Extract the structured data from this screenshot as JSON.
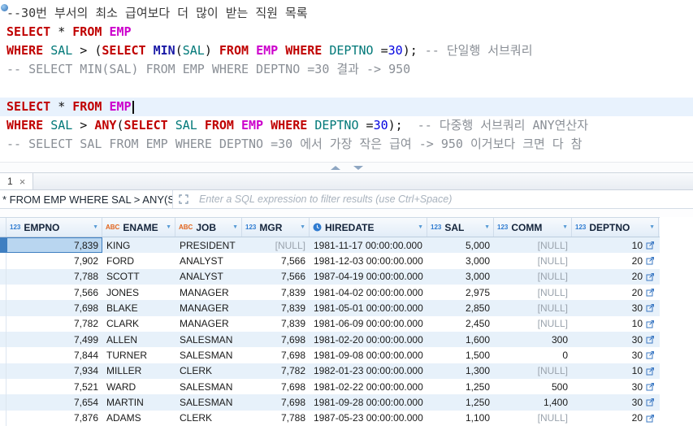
{
  "editor": {
    "lines": [
      {
        "tokens": [
          [
            "cmt1",
            "--30번 부서의 최소 급여보다 더 많이 받는 직원 목록"
          ]
        ]
      },
      {
        "tokens": [
          [
            "kw",
            "SELECT"
          ],
          [
            "pl",
            " * "
          ],
          [
            "kw",
            "FROM"
          ],
          [
            "pl",
            " "
          ],
          [
            "tbl",
            "EMP"
          ]
        ]
      },
      {
        "tokens": [
          [
            "kw",
            "WHERE"
          ],
          [
            "pl",
            " "
          ],
          [
            "col",
            "SAL"
          ],
          [
            "pl",
            " > ("
          ],
          [
            "kw",
            "SELECT"
          ],
          [
            "pl",
            " "
          ],
          [
            "fn",
            "MIN"
          ],
          [
            "pl",
            "("
          ],
          [
            "col",
            "SAL"
          ],
          [
            "pl",
            ") "
          ],
          [
            "kw",
            "FROM"
          ],
          [
            "pl",
            " "
          ],
          [
            "tbl",
            "EMP"
          ],
          [
            "pl",
            " "
          ],
          [
            "kw",
            "WHERE"
          ],
          [
            "pl",
            " "
          ],
          [
            "col",
            "DEPTNO"
          ],
          [
            "pl",
            " ="
          ],
          [
            "num",
            "30"
          ],
          [
            "pl",
            "); "
          ],
          [
            "cmt",
            "-- 단일행 서브쿼리"
          ]
        ]
      },
      {
        "tokens": [
          [
            "cmt",
            "-- SELECT MIN(SAL) FROM EMP WHERE DEPTNO =30 결과 -> 950"
          ]
        ]
      },
      {
        "tokens": []
      },
      {
        "current": true,
        "caret": true,
        "tokens": [
          [
            "kw",
            "SELECT"
          ],
          [
            "pl",
            " * "
          ],
          [
            "kw",
            "FROM"
          ],
          [
            "pl",
            " "
          ],
          [
            "tbl",
            "EMP"
          ]
        ]
      },
      {
        "tokens": [
          [
            "kw",
            "WHERE"
          ],
          [
            "pl",
            " "
          ],
          [
            "col",
            "SAL"
          ],
          [
            "pl",
            " > "
          ],
          [
            "kw",
            "ANY"
          ],
          [
            "pl",
            "("
          ],
          [
            "kw",
            "SELECT"
          ],
          [
            "pl",
            " "
          ],
          [
            "col",
            "SAL"
          ],
          [
            "pl",
            " "
          ],
          [
            "kw",
            "FROM"
          ],
          [
            "pl",
            " "
          ],
          [
            "tbl",
            "EMP"
          ],
          [
            "pl",
            " "
          ],
          [
            "kw",
            "WHERE"
          ],
          [
            "pl",
            " "
          ],
          [
            "col",
            "DEPTNO"
          ],
          [
            "pl",
            " ="
          ],
          [
            "num",
            "30"
          ],
          [
            "pl",
            ");  "
          ],
          [
            "cmt",
            "-- 다중행 서브쿼리 ANY연산자"
          ]
        ]
      },
      {
        "tokens": [
          [
            "cmt",
            "-- SELECT SAL FROM EMP WHERE DEPTNO =30 에서 가장 작은 급여 -> 950 이거보다 크면 다 참"
          ]
        ]
      }
    ]
  },
  "results_tab": {
    "label": "1",
    "close": "×"
  },
  "filter": {
    "expression": "* FROM EMP WHERE SAL > ANY(SELEC",
    "placeholder": "Enter a SQL expression to filter results (use Ctrl+Space)"
  },
  "grid": {
    "columns": [
      {
        "type": "123",
        "name": "EMPNO"
      },
      {
        "type": "ABC",
        "name": "ENAME"
      },
      {
        "type": "ABC",
        "name": "JOB"
      },
      {
        "type": "123",
        "name": "MGR"
      },
      {
        "type": "clock",
        "name": "HIREDATE"
      },
      {
        "type": "123",
        "name": "SAL"
      },
      {
        "type": "123",
        "name": "COMM"
      },
      {
        "type": "123",
        "name": "DEPTNO",
        "link": true
      }
    ],
    "filter_arrow": "▼",
    "null_text": "[NULL]",
    "selected": {
      "row": 0,
      "col": 0
    },
    "rows": [
      [
        "7,839",
        "KING",
        "PRESIDENT",
        null,
        "1981-11-17 00:00:00.000",
        "5,000",
        null,
        "10"
      ],
      [
        "7,902",
        "FORD",
        "ANALYST",
        "7,566",
        "1981-12-03 00:00:00.000",
        "3,000",
        null,
        "20"
      ],
      [
        "7,788",
        "SCOTT",
        "ANALYST",
        "7,566",
        "1987-04-19 00:00:00.000",
        "3,000",
        null,
        "20"
      ],
      [
        "7,566",
        "JONES",
        "MANAGER",
        "7,839",
        "1981-04-02 00:00:00.000",
        "2,975",
        null,
        "20"
      ],
      [
        "7,698",
        "BLAKE",
        "MANAGER",
        "7,839",
        "1981-05-01 00:00:00.000",
        "2,850",
        null,
        "30"
      ],
      [
        "7,782",
        "CLARK",
        "MANAGER",
        "7,839",
        "1981-06-09 00:00:00.000",
        "2,450",
        null,
        "10"
      ],
      [
        "7,499",
        "ALLEN",
        "SALESMAN",
        "7,698",
        "1981-02-20 00:00:00.000",
        "1,600",
        "300",
        "30"
      ],
      [
        "7,844",
        "TURNER",
        "SALESMAN",
        "7,698",
        "1981-09-08 00:00:00.000",
        "1,500",
        "0",
        "30"
      ],
      [
        "7,934",
        "MILLER",
        "CLERK",
        "7,782",
        "1982-01-23 00:00:00.000",
        "1,300",
        null,
        "10"
      ],
      [
        "7,521",
        "WARD",
        "SALESMAN",
        "7,698",
        "1981-02-22 00:00:00.000",
        "1,250",
        "500",
        "30"
      ],
      [
        "7,654",
        "MARTIN",
        "SALESMAN",
        "7,698",
        "1981-09-28 00:00:00.000",
        "1,250",
        "1,400",
        "30"
      ],
      [
        "7,876",
        "ADAMS",
        "CLERK",
        "7,788",
        "1987-05-23 00:00:00.000",
        "1,100",
        null,
        "20"
      ]
    ]
  }
}
